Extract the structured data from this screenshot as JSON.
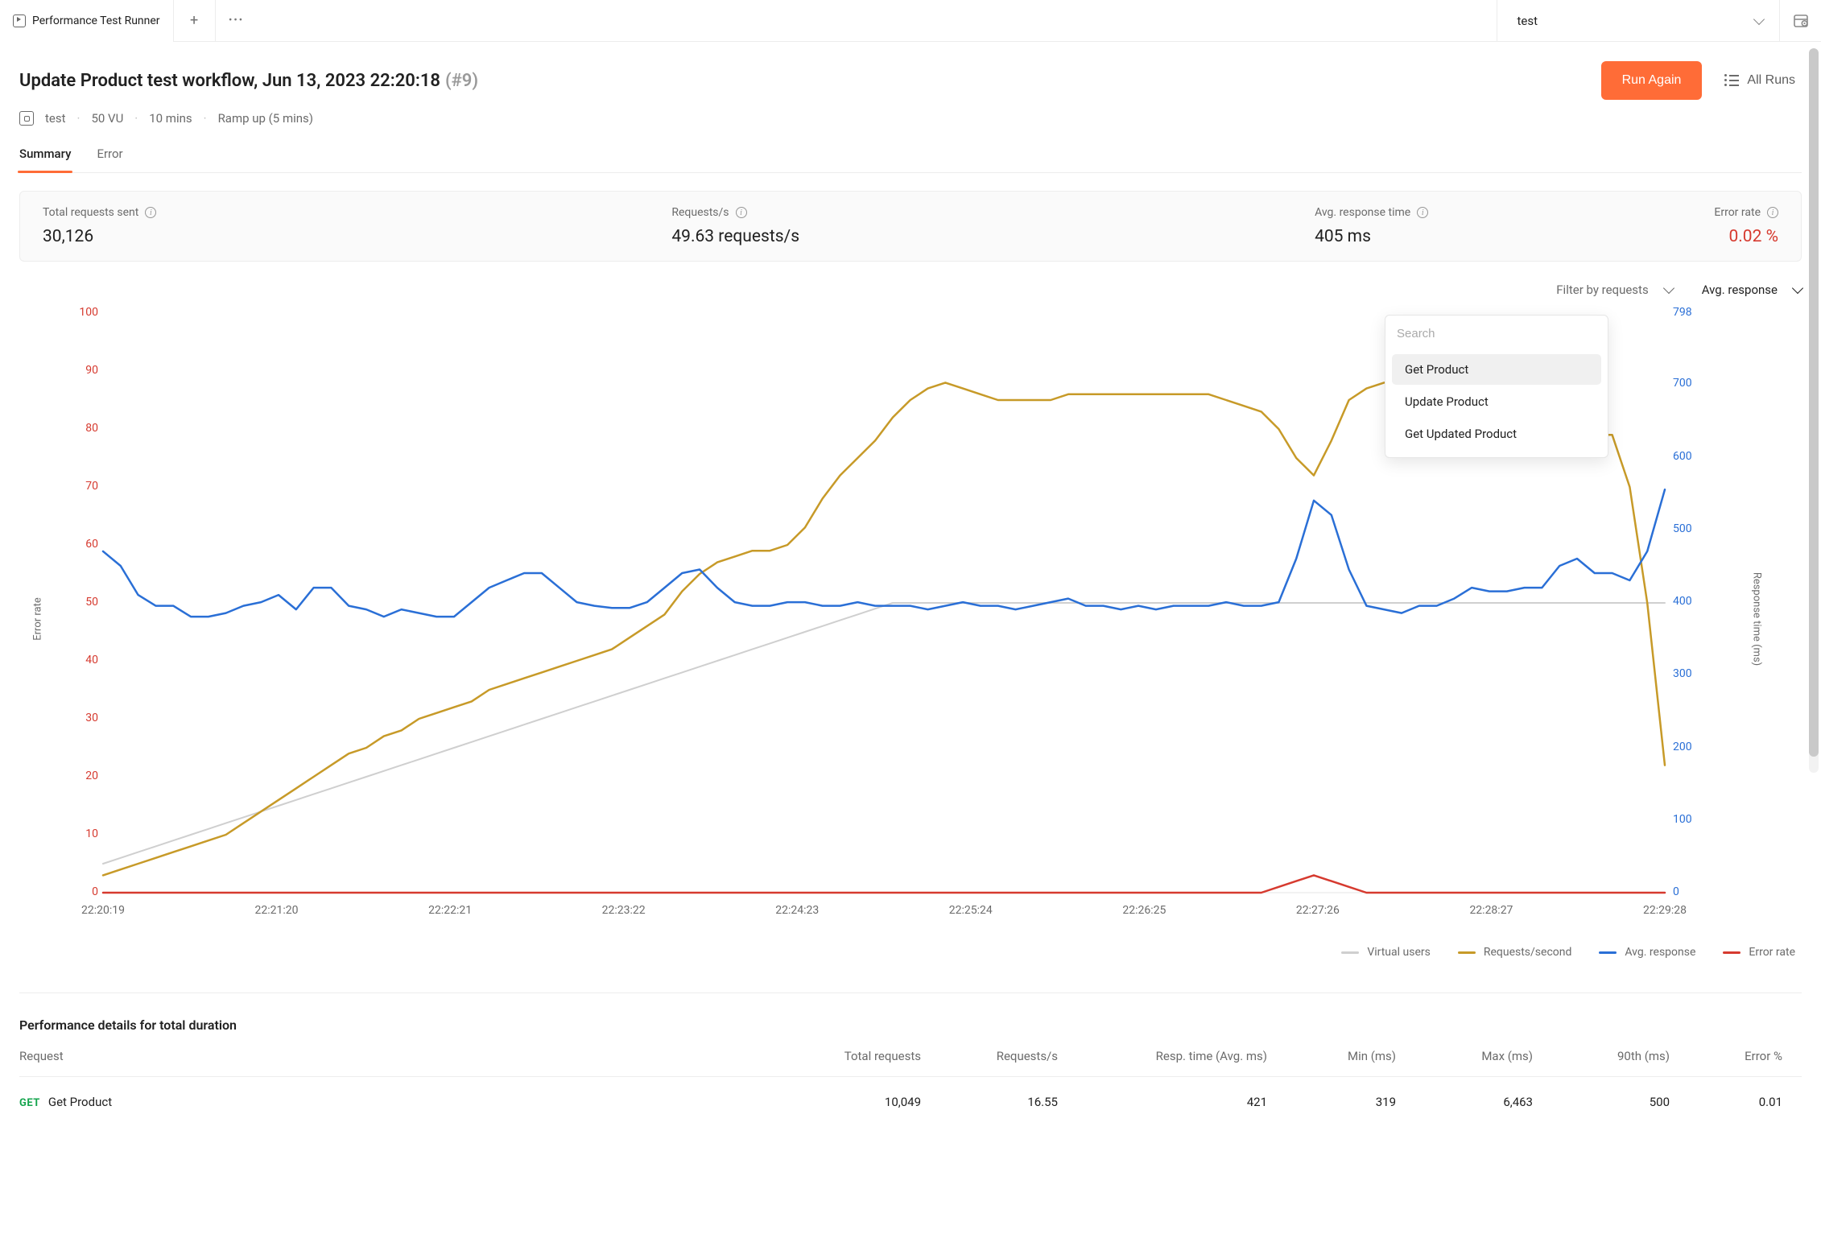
{
  "topbar": {
    "tab_label": "Performance Test Runner",
    "workspace": "test"
  },
  "header": {
    "title": "Update Product test workflow, Jun 13, 2023 22:20:18",
    "run_number": "(#9)",
    "meta": {
      "env": "test",
      "vu": "50 VU",
      "duration": "10 mins",
      "ramp": "Ramp up (5 mins)"
    },
    "run_again": "Run Again",
    "all_runs": "All Runs"
  },
  "tabs": {
    "summary": "Summary",
    "error": "Error"
  },
  "metrics": {
    "total_requests_label": "Total requests sent",
    "total_requests_value": "30,126",
    "rps_label": "Requests/s",
    "rps_value": "49.63 requests/s",
    "avg_rt_label": "Avg. response time",
    "avg_rt_value": "405 ms",
    "error_rate_label": "Error rate",
    "error_rate_value": "0.02 %"
  },
  "controls": {
    "filter_label": "Filter by requests",
    "metric_label": "Avg. response",
    "search_placeholder": "Search",
    "options": [
      "Get Product",
      "Update Product",
      "Get Updated Product"
    ]
  },
  "legend": {
    "vu": "Virtual users",
    "rps": "Requests/second",
    "avg": "Avg. response",
    "err": "Error rate"
  },
  "axes": {
    "x": [
      "22:20:19",
      "22:21:20",
      "22:22:21",
      "22:23:22",
      "22:24:23",
      "22:25:24",
      "22:26:25",
      "22:27:26",
      "22:28:27",
      "22:29:28"
    ],
    "left": [
      "0",
      "10",
      "20",
      "30",
      "40",
      "50",
      "60",
      "70",
      "80",
      "90",
      "100"
    ],
    "right": [
      "0",
      "100",
      "200",
      "300",
      "400",
      "500",
      "600",
      "700",
      "798"
    ],
    "left_title": "Error rate",
    "right_title": "Response time (ms)"
  },
  "colors": {
    "vu": "#cfcfcf",
    "rps": "#c79a28",
    "avg": "#2a6fd6",
    "err": "#d63a2f",
    "accent": "#ff6c37"
  },
  "perf": {
    "title": "Performance details for total duration",
    "headers": {
      "request": "Request",
      "total": "Total requests",
      "rps": "Requests/s",
      "rt_avg": "Resp. time (Avg. ms)",
      "min": "Min (ms)",
      "max": "Max (ms)",
      "p90": "90th (ms)",
      "err": "Error %"
    },
    "rows": [
      {
        "method": "GET",
        "name": "Get Product",
        "total": "10,049",
        "rps": "16.55",
        "rt_avg": "421",
        "min": "319",
        "max": "6,463",
        "p90": "500",
        "err": "0.01"
      }
    ]
  },
  "chart_data": {
    "type": "line",
    "xlabel": "",
    "x": [
      "22:20:19",
      "22:21:20",
      "22:22:21",
      "22:23:22",
      "22:24:23",
      "22:25:24",
      "22:26:25",
      "22:27:26",
      "22:28:27",
      "22:29:28"
    ],
    "left_axis": {
      "label": "Error rate",
      "range": [
        0,
        100
      ],
      "ticks": [
        0,
        10,
        20,
        30,
        40,
        50,
        60,
        70,
        80,
        90,
        100
      ]
    },
    "right_axis": {
      "label": "Response time (ms)",
      "range": [
        0,
        798
      ],
      "ticks": [
        0,
        100,
        200,
        300,
        400,
        500,
        600,
        700,
        798
      ]
    },
    "series": [
      {
        "name": "Virtual users",
        "axis": "left",
        "color": "#cfcfcf",
        "values_90pts": [
          5,
          6,
          7,
          8,
          9,
          10,
          11,
          12,
          13,
          14,
          15,
          16,
          17,
          18,
          19,
          20,
          21,
          22,
          23,
          24,
          25,
          26,
          27,
          28,
          29,
          30,
          31,
          32,
          33,
          34,
          35,
          36,
          37,
          38,
          39,
          40,
          41,
          42,
          43,
          44,
          45,
          46,
          47,
          48,
          49,
          50,
          50,
          50,
          50,
          50,
          50,
          50,
          50,
          50,
          50,
          50,
          50,
          50,
          50,
          50,
          50,
          50,
          50,
          50,
          50,
          50,
          50,
          50,
          50,
          50,
          50,
          50,
          50,
          50,
          50,
          50,
          50,
          50,
          50,
          50,
          50,
          50,
          50,
          50,
          50,
          50,
          50,
          50,
          50,
          50
        ]
      },
      {
        "name": "Requests/second",
        "axis": "left",
        "color": "#c79a28",
        "values_90pts": [
          3,
          4,
          5,
          6,
          7,
          8,
          9,
          10,
          12,
          14,
          16,
          18,
          20,
          22,
          24,
          25,
          27,
          28,
          30,
          31,
          32,
          33,
          35,
          36,
          37,
          38,
          39,
          40,
          41,
          42,
          44,
          46,
          48,
          52,
          55,
          57,
          58,
          59,
          59,
          60,
          63,
          68,
          72,
          75,
          78,
          82,
          85,
          87,
          88,
          87,
          86,
          85,
          85,
          85,
          85,
          86,
          86,
          86,
          86,
          86,
          86,
          86,
          86,
          86,
          85,
          84,
          83,
          80,
          75,
          72,
          78,
          85,
          87,
          88,
          88,
          87,
          87,
          86,
          86,
          86,
          86,
          85,
          84,
          80,
          79,
          79,
          79,
          70,
          50,
          22
        ]
      },
      {
        "name": "Avg. response",
        "axis": "right",
        "color": "#2a6fd6",
        "values_90pts": [
          470,
          450,
          410,
          395,
          395,
          380,
          380,
          385,
          395,
          400,
          410,
          390,
          420,
          420,
          395,
          390,
          380,
          390,
          385,
          380,
          380,
          400,
          420,
          430,
          440,
          440,
          420,
          400,
          395,
          392,
          392,
          400,
          420,
          440,
          445,
          420,
          400,
          395,
          395,
          400,
          400,
          395,
          395,
          400,
          395,
          395,
          395,
          390,
          395,
          400,
          395,
          395,
          390,
          395,
          400,
          405,
          395,
          395,
          390,
          395,
          390,
          395,
          395,
          395,
          400,
          395,
          395,
          400,
          460,
          540,
          520,
          445,
          395,
          390,
          385,
          395,
          395,
          405,
          420,
          415,
          415,
          420,
          420,
          450,
          460,
          440,
          440,
          430,
          470,
          555
        ]
      },
      {
        "name": "Error rate",
        "axis": "left",
        "color": "#d63a2f",
        "values_90pts": [
          0,
          0,
          0,
          0,
          0,
          0,
          0,
          0,
          0,
          0,
          0,
          0,
          0,
          0,
          0,
          0,
          0,
          0,
          0,
          0,
          0,
          0,
          0,
          0,
          0,
          0,
          0,
          0,
          0,
          0,
          0,
          0,
          0,
          0,
          0,
          0,
          0,
          0,
          0,
          0,
          0,
          0,
          0,
          0,
          0,
          0,
          0,
          0,
          0,
          0,
          0,
          0,
          0,
          0,
          0,
          0,
          0,
          0,
          0,
          0,
          0,
          0,
          0,
          0,
          0,
          0,
          0,
          1,
          2,
          3,
          2,
          1,
          0,
          0,
          0,
          0,
          0,
          0,
          0,
          0,
          0,
          0,
          0,
          0,
          0,
          0,
          0,
          0,
          0,
          0
        ]
      }
    ]
  }
}
